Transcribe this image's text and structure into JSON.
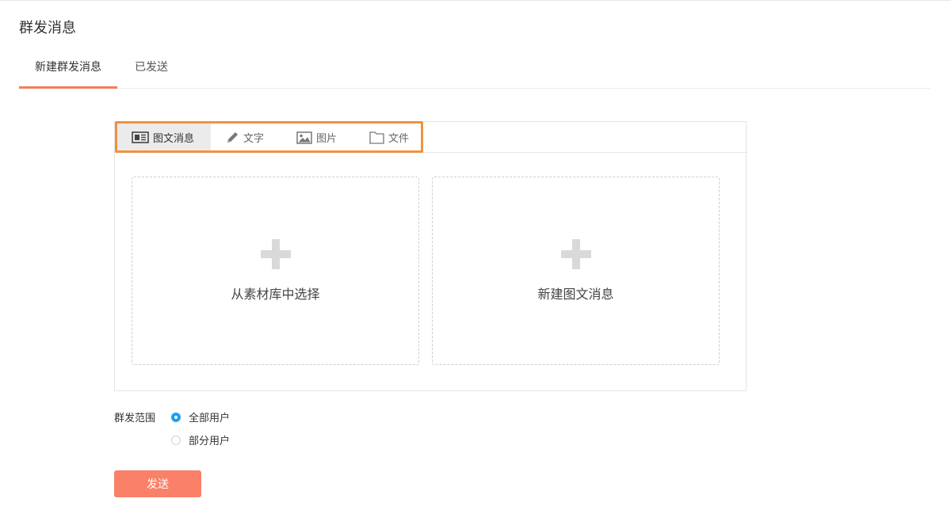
{
  "page": {
    "title": "群发消息"
  },
  "tabs": [
    {
      "label": "新建群发消息",
      "active": true
    },
    {
      "label": "已发送",
      "active": false
    }
  ],
  "message_types": [
    {
      "label": "图文消息",
      "icon": "news-icon",
      "active": true
    },
    {
      "label": "文字",
      "icon": "pencil-icon",
      "active": false
    },
    {
      "label": "图片",
      "icon": "image-icon",
      "active": false
    },
    {
      "label": "文件",
      "icon": "file-icon",
      "active": false
    }
  ],
  "cards": [
    {
      "label": "从素材库中选择",
      "icon": "plus-icon"
    },
    {
      "label": "新建图文消息",
      "icon": "plus-icon"
    }
  ],
  "scope": {
    "label": "群发范围",
    "options": [
      {
        "label": "全部用户",
        "checked": true
      },
      {
        "label": "部分用户",
        "checked": false
      }
    ]
  },
  "send_button": {
    "label": "发送"
  },
  "colors": {
    "accent": "#f27d5d",
    "highlight_border": "#f0923f",
    "radio_checked": "#1aa1f0",
    "send_button": "#fa8068"
  }
}
